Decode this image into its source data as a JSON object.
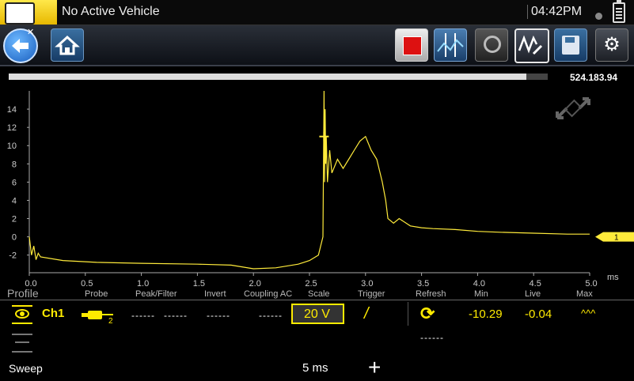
{
  "header": {
    "title": "No Active Vehicle",
    "time": "04:42PM"
  },
  "progress": {
    "value_text": "524.183.94",
    "fraction": 0.96
  },
  "chart_data": {
    "type": "line",
    "xlabel": "",
    "x_unit": "ms",
    "xlim": [
      0.0,
      5.0
    ],
    "ylim": [
      -3.5,
      16
    ],
    "x_ticks": [
      "0.0",
      "0.5",
      "1.0",
      "1.5",
      "2.0",
      "2.5",
      "3.0",
      "3.5",
      "4.0",
      "4.5",
      "5.0"
    ],
    "y_ticks": [
      "14",
      "12",
      "10",
      "8",
      "6",
      "4",
      "2",
      "0",
      "-2"
    ],
    "trigger_marker": {
      "x": 2.63,
      "y": 11
    },
    "channel_marker_label": "1",
    "color": "#ffeb3b",
    "series": [
      {
        "x": [
          0.0,
          0.02,
          0.04,
          0.06,
          0.08,
          0.1,
          0.3,
          0.6,
          1.0,
          1.5,
          1.8,
          2.0,
          2.2,
          2.4,
          2.5,
          2.58,
          2.62,
          2.63,
          2.635,
          2.64,
          2.645,
          2.65,
          2.66,
          2.68,
          2.7,
          2.75,
          2.8,
          2.85,
          2.9,
          2.95,
          3.0,
          3.05,
          3.1,
          3.15,
          3.18,
          3.2,
          3.25,
          3.3,
          3.4,
          3.5,
          3.6,
          3.8,
          4.0,
          4.2,
          4.5,
          4.8,
          5.0
        ],
        "y": [
          0,
          -2,
          -1,
          -2.5,
          -1.8,
          -2.2,
          -2.6,
          -2.8,
          -2.9,
          -3.0,
          -3.1,
          -3.5,
          -3.4,
          -3.0,
          -2.6,
          -2.0,
          0,
          16,
          6,
          14,
          8,
          11,
          6,
          9.5,
          7,
          8.5,
          7.5,
          8.5,
          9.5,
          10.5,
          11,
          9.5,
          8.5,
          6,
          4,
          2,
          1.5,
          2,
          1.2,
          1.0,
          0.9,
          0.8,
          0.6,
          0.5,
          0.4,
          0.3,
          0.3
        ]
      }
    ]
  },
  "controls": {
    "profile_label": "Profile",
    "headers": {
      "probe": "Probe",
      "peak_filter": "Peak/Filter",
      "invert": "Invert",
      "coupling": "Coupling AC",
      "scale": "Scale",
      "trigger": "Trigger",
      "refresh": "Refresh",
      "min": "Min",
      "live": "Live",
      "max": "Max"
    },
    "ch1": {
      "label": "Ch1",
      "peak_filter_a": "------",
      "peak_filter_b": "------",
      "invert": "------",
      "coupling": "------",
      "scale": "20 V",
      "min": "-10.29",
      "live": "-0.04",
      "max": "^^^"
    },
    "refresh_sub": "------",
    "sweep_label": "Sweep",
    "sweep_value": "5 ms",
    "plus": "+"
  }
}
